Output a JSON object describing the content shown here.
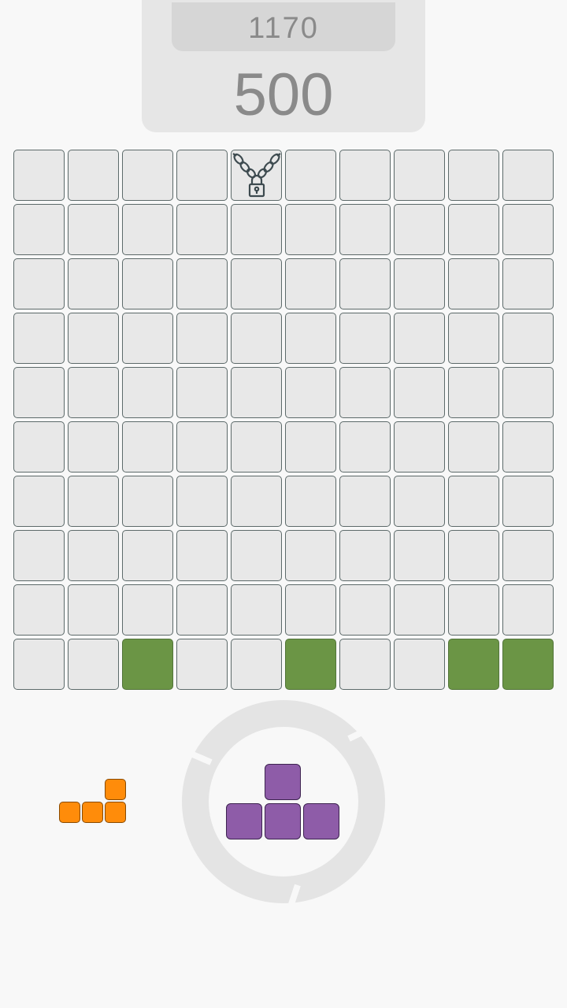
{
  "score": {
    "best": "1170",
    "current": "500"
  },
  "board": {
    "rows": 10,
    "cols": 10,
    "locked_cells": [
      [
        0,
        4
      ]
    ],
    "filled_cells": [
      [
        9,
        2
      ],
      [
        9,
        5
      ],
      [
        9,
        8
      ],
      [
        9,
        9
      ]
    ]
  },
  "tray": {
    "small_piece": {
      "color": "#ff8c0a",
      "shape": "L",
      "blocks": [
        [
          0,
          2
        ],
        [
          1,
          0
        ],
        [
          1,
          1
        ],
        [
          1,
          2
        ]
      ]
    },
    "active_piece": {
      "color": "#8e5ca8",
      "shape": "T",
      "blocks": [
        [
          0,
          1
        ],
        [
          1,
          0
        ],
        [
          1,
          1
        ],
        [
          1,
          2
        ]
      ]
    },
    "rotate_icon": "rotate-ring-icon"
  },
  "colors": {
    "background": "#f8f8f8",
    "cell_empty": "#e8e8e8",
    "cell_filled": "#6b9545",
    "panel": "#e6e6e6",
    "score_text": "#8a8a8a"
  }
}
